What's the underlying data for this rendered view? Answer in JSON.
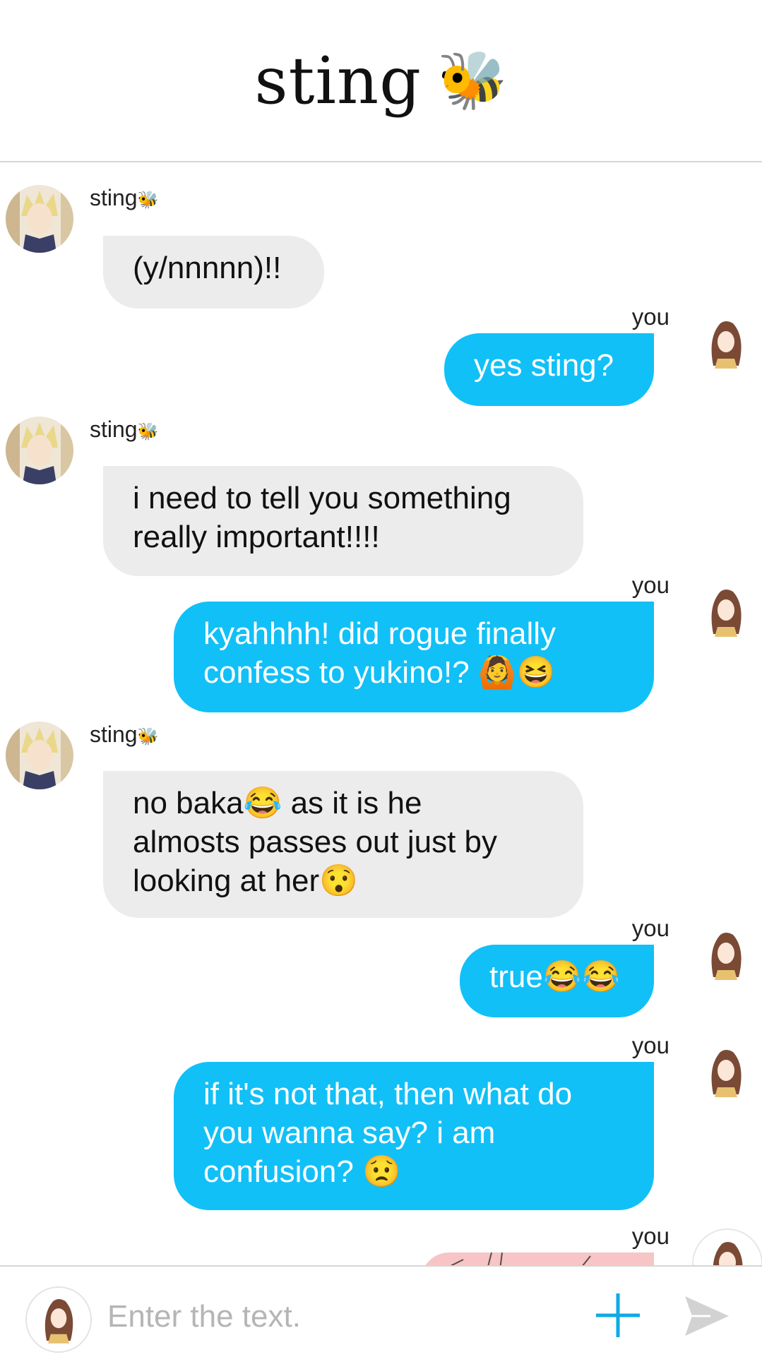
{
  "header": {
    "title": "sting",
    "title_emoji": "🐝"
  },
  "messages": [
    {
      "from": "them",
      "sender": "sting",
      "sender_emoji": "🐝",
      "text": "(y/nnnnn)!!"
    },
    {
      "from": "me",
      "sender": "you",
      "text": "yes sting?"
    },
    {
      "from": "them",
      "sender": "sting",
      "sender_emoji": "🐝",
      "text": "i need to tell you something\nreally important!!!!"
    },
    {
      "from": "me",
      "sender": "you",
      "text": "kyahhhh! did rogue finally\nconfess to yukino!? 🙆😆"
    },
    {
      "from": "them",
      "sender": "sting",
      "sender_emoji": "🐝",
      "text": "no baka😂 as it is he\nalmosts passes out just by\nlooking at her😯"
    },
    {
      "from": "me",
      "sender": "you",
      "text": "true😂😂"
    },
    {
      "from": "me",
      "sender": "you",
      "text": "if it's not that, then what do\nyou wanna say? i am\nconfusion? 😟"
    },
    {
      "from": "me",
      "sender": "you",
      "text": ""
    }
  ],
  "composer": {
    "placeholder": "Enter the text."
  },
  "colors": {
    "outgoing_bubble": "#11c0f7",
    "incoming_bubble": "#ececec",
    "image_bubble": "#f7c5c5"
  },
  "icons": {
    "add": "plus-icon",
    "send": "send-icon"
  }
}
